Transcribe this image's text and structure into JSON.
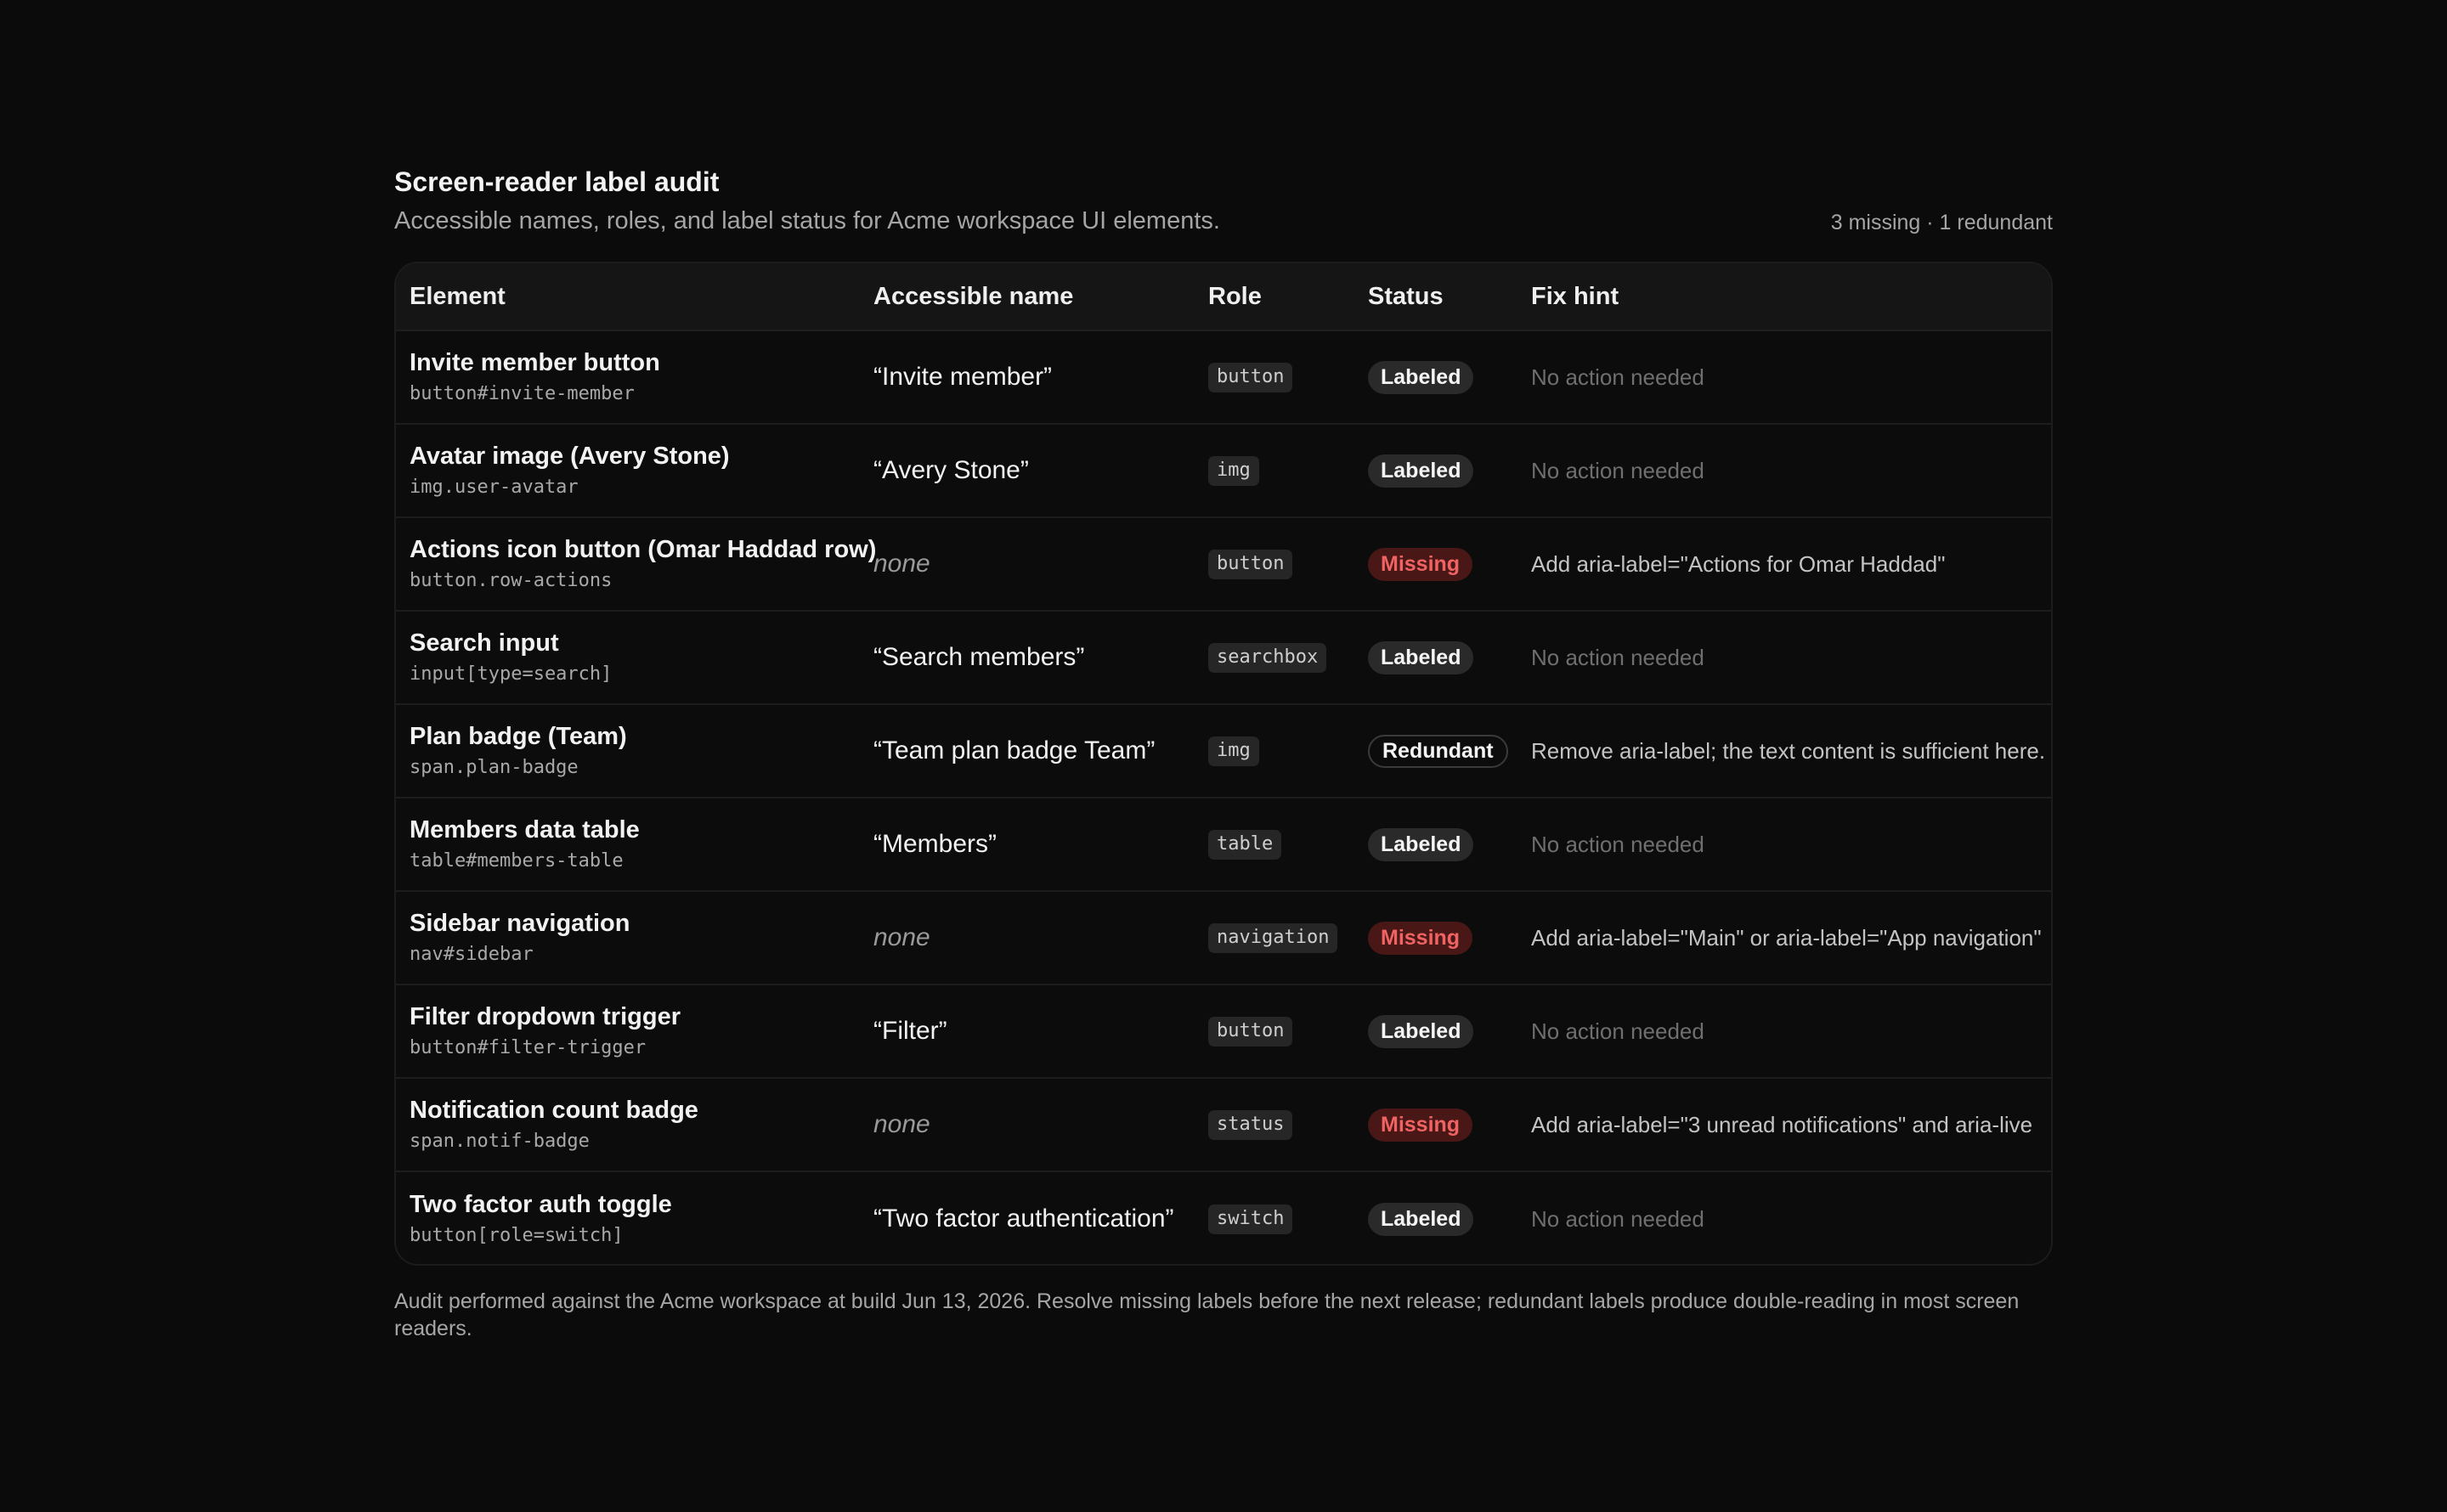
{
  "header": {
    "title": "Screen-reader label audit",
    "subtitle": "Accessible names, roles, and label status for Acme workspace UI elements.",
    "summary": "3 missing · 1 redundant"
  },
  "table": {
    "columns": [
      "Element",
      "Accessible name",
      "Role",
      "Status",
      "Fix hint"
    ],
    "rows": [
      {
        "element": "Invite member button",
        "selector": "button#invite-member",
        "accessible_name": "“Invite member”",
        "name_present": true,
        "role": "button",
        "status": "Labeled",
        "hint": "No action needed"
      },
      {
        "element": "Avatar image (Avery Stone)",
        "selector": "img.user-avatar",
        "accessible_name": "“Avery Stone”",
        "name_present": true,
        "role": "img",
        "status": "Labeled",
        "hint": "No action needed"
      },
      {
        "element": "Actions icon button (Omar Haddad row)",
        "selector": "button.row-actions",
        "accessible_name": "none",
        "name_present": false,
        "role": "button",
        "status": "Missing",
        "hint": "Add aria-label=\"Actions for Omar Haddad\""
      },
      {
        "element": "Search input",
        "selector": "input[type=search]",
        "accessible_name": "“Search members”",
        "name_present": true,
        "role": "searchbox",
        "status": "Labeled",
        "hint": "No action needed"
      },
      {
        "element": "Plan badge (Team)",
        "selector": "span.plan-badge",
        "accessible_name": "“Team plan badge Team”",
        "name_present": true,
        "role": "img",
        "status": "Redundant",
        "hint": "Remove aria-label; the text content is sufficient here."
      },
      {
        "element": "Members data table",
        "selector": "table#members-table",
        "accessible_name": "“Members”",
        "name_present": true,
        "role": "table",
        "status": "Labeled",
        "hint": "No action needed"
      },
      {
        "element": "Sidebar navigation",
        "selector": "nav#sidebar",
        "accessible_name": "none",
        "name_present": false,
        "role": "navigation",
        "status": "Missing",
        "hint": "Add aria-label=\"Main\" or aria-label=\"App navigation\""
      },
      {
        "element": "Filter dropdown trigger",
        "selector": "button#filter-trigger",
        "accessible_name": "“Filter”",
        "name_present": true,
        "role": "button",
        "status": "Labeled",
        "hint": "No action needed"
      },
      {
        "element": "Notification count badge",
        "selector": "span.notif-badge",
        "accessible_name": "none",
        "name_present": false,
        "role": "status",
        "status": "Missing",
        "hint": "Add aria-label=\"3 unread notifications\" and aria-live"
      },
      {
        "element": "Two factor auth toggle",
        "selector": "button[role=switch]",
        "accessible_name": "“Two factor authentication”",
        "name_present": true,
        "role": "switch",
        "status": "Labeled",
        "hint": "No action needed"
      }
    ]
  },
  "footer": {
    "note": "Audit performed against the Acme workspace at build Jun 13, 2026. Resolve missing labels before the next release; redundant labels produce double-reading in most screen readers."
  },
  "colors": {
    "background": "#0b0b0b",
    "missing_text": "#f06363",
    "missing_bg": "#4a1717",
    "labeled_bg": "#2a2a2a"
  }
}
